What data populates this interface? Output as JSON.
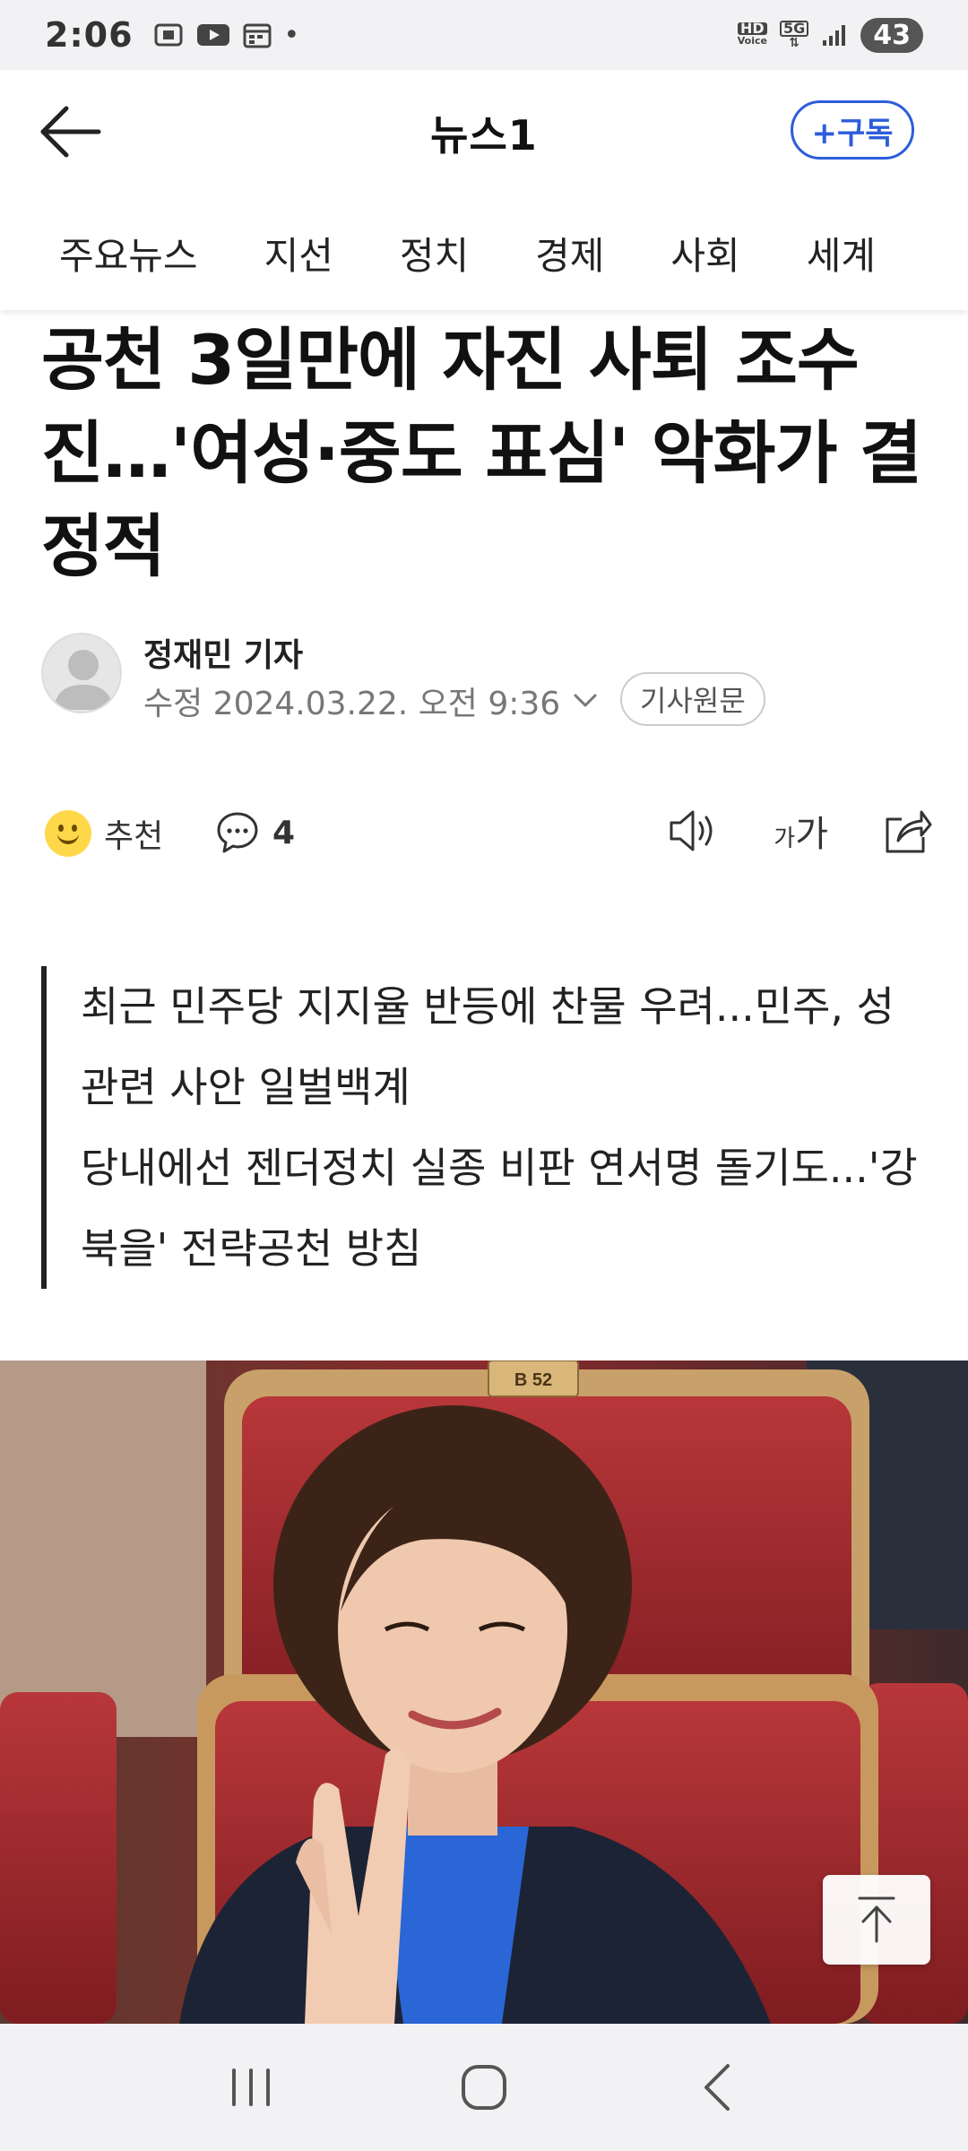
{
  "status_bar": {
    "time": "2:06",
    "dot": "•",
    "hd_label": "HD",
    "voice_label": "Voice",
    "network": "5G",
    "battery": "43"
  },
  "header": {
    "title": "뉴스1",
    "subscribe_label": "+구독"
  },
  "tabs": [
    "주요뉴스",
    "지선",
    "정치",
    "경제",
    "사회",
    "세계"
  ],
  "article": {
    "headline": "공천 3일만에 자진 사퇴 조수진…'여성·중도 표심' 악화가 결정적",
    "author": "정재민 기자",
    "date": "수정 2024.03.22. 오전 9:36",
    "original_label": "기사원문",
    "recommend_label": "추천",
    "comment_count": "4",
    "font_size_small": "가",
    "font_size_large": "가",
    "summary": [
      "최근 민주당 지지율 반등에 찬물 우려...민주, 성 관련 사안 일벌백계",
      "당내에선 젠더정치 실종 비판 연서명 돌기도...'강북을' 전략공천 방침"
    ],
    "photo_seat_label": "B 52"
  },
  "icons": {
    "back": "arrow-left-icon",
    "comment": "chat-bubble-icon",
    "speaker": "speaker-icon",
    "share": "share-icon",
    "scroll_top": "arrow-up-icon",
    "nav_recent": "recent-apps-icon",
    "nav_home": "home-icon",
    "nav_back": "chevron-left-icon"
  }
}
